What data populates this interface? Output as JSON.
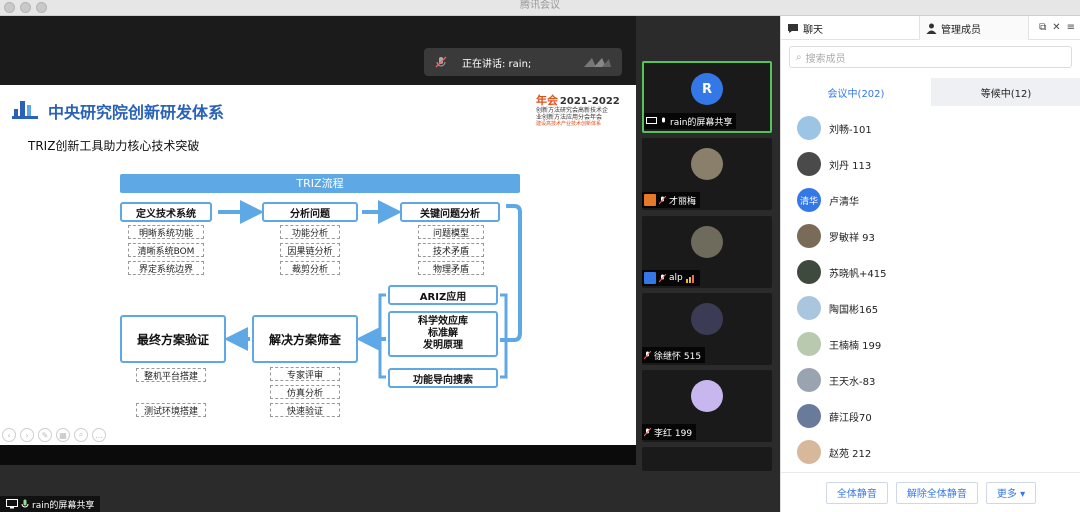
{
  "window": {
    "title": "腾讯会议"
  },
  "speaking": {
    "text": "正在讲话: rain;"
  },
  "slide": {
    "title": "中央研究院创新研发体系",
    "subtitle": "TRIZ创新工具助力核心技术突破",
    "brand": {
      "year_label": "年会",
      "years": "2021-2022",
      "line1": "创新方法研究会高新技术企",
      "line2": "业创新方法应用分会年会",
      "tagline": "建设高技术产业技术创新体系"
    },
    "flow_title": "TRIZ流程",
    "steps": {
      "define": "定义技术系统",
      "analyze": "分析问题",
      "key": "关键问题分析",
      "ariz": "ARIZ应用",
      "science": [
        "科学效应库",
        "标准解",
        "发明原理"
      ],
      "func": "功能导向搜索",
      "screen": "解决方案筛查",
      "final": "最终方案验证"
    },
    "define_items": [
      "明晰系统功能",
      "清晰系统BOM",
      "界定系统边界"
    ],
    "analyze_items": [
      "功能分析",
      "因果链分析",
      "裁剪分析"
    ],
    "key_items": [
      "问题模型",
      "技术矛盾",
      "物理矛盾"
    ],
    "screen_items": [
      "专家评审",
      "仿真分析",
      "快速验证"
    ],
    "final_items": [
      "整机平台搭建",
      "测试环境搭建"
    ]
  },
  "share_tag": "rain的屏幕共享",
  "video_tiles": [
    {
      "initial": "R",
      "label": "rain的屏幕共享",
      "color": "#3478e8"
    },
    {
      "label": "才丽梅",
      "color": "#8a7f6a"
    },
    {
      "label": "alp",
      "color": "#6e6a5c"
    },
    {
      "label": "徐继怀 515",
      "color": "#3b3b55"
    },
    {
      "label": "李红 199",
      "color": "#c8b6ee"
    }
  ],
  "panel": {
    "tab_chat": "聊天",
    "tab_members": "管理成员",
    "search_placeholder": "搜索成员",
    "tab_in_meeting": "会议中(202)",
    "tab_waiting": "等候中(12)",
    "members": [
      {
        "name": "刘畅-101",
        "color": "#9cc4e4",
        "initial": ""
      },
      {
        "name": "刘丹 113",
        "color": "#4a4a4a",
        "initial": ""
      },
      {
        "name": "卢清华",
        "color": "#3478e8",
        "initial": "清华"
      },
      {
        "name": "罗敏祥 93",
        "color": "#7a6a58",
        "initial": ""
      },
      {
        "name": "苏晓帆+415",
        "color": "#3f4a3f",
        "initial": ""
      },
      {
        "name": "陶国彬165",
        "color": "#a9c6de",
        "initial": ""
      },
      {
        "name": "王楠楠 199",
        "color": "#b8c9b0",
        "initial": ""
      },
      {
        "name": "王天水-83",
        "color": "#9aa4b0",
        "initial": ""
      },
      {
        "name": "薛江段70",
        "color": "#6a7a9a",
        "initial": ""
      },
      {
        "name": "赵苑 212",
        "color": "#d8b89a",
        "initial": ""
      }
    ],
    "btn_mute_all": "全体静音",
    "btn_unmute_all": "解除全体静音",
    "btn_more": "更多 ▾"
  }
}
